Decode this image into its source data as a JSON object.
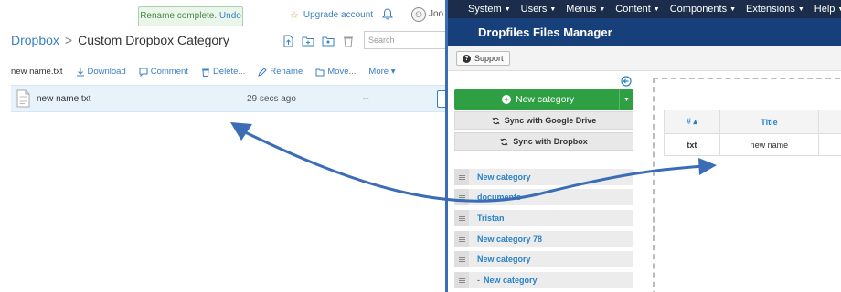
{
  "dropbox": {
    "toast": {
      "text": "Rename complete.",
      "undo": "Undo"
    },
    "upgrade_label": "Upgrade account",
    "username": "Joo",
    "breadcrumb": {
      "root": "Dropbox",
      "separator": ">",
      "current": "Custom Dropbox Category"
    },
    "search_placeholder": "Search",
    "actions": {
      "selected_file": "new name.txt",
      "download": "Download",
      "comment": "Comment",
      "delete": "Delete...",
      "rename": "Rename",
      "move": "Move...",
      "more": "More"
    },
    "file": {
      "name": "new name.txt",
      "modified": "29 secs ago",
      "size": "--"
    }
  },
  "joomla": {
    "menu": [
      "System",
      "Users",
      "Menus",
      "Content",
      "Components",
      "Extensions",
      "Help"
    ],
    "page_title": "Dropfiles Files Manager",
    "support_label": "Support",
    "new_category_label": "New category",
    "sync_google": "Sync with Google Drive",
    "sync_dropbox": "Sync with Dropbox",
    "categories": [
      {
        "label": "New category"
      },
      {
        "label": "documents"
      },
      {
        "label": "Tristan"
      },
      {
        "label": "New category 78"
      },
      {
        "label": "New category"
      },
      {
        "label": "New category",
        "prefix": "-"
      }
    ],
    "table": {
      "headers": [
        "#",
        "Title"
      ],
      "rows": [
        {
          "ext": "txt",
          "title": "new name"
        }
      ]
    }
  },
  "colors": {
    "dropbox_accent": "#3a7fc4",
    "joomla_nav": "#1b2d4a",
    "joomla_header": "#17407a",
    "new_button": "#2ea043",
    "arrow": "#3a6db5"
  }
}
